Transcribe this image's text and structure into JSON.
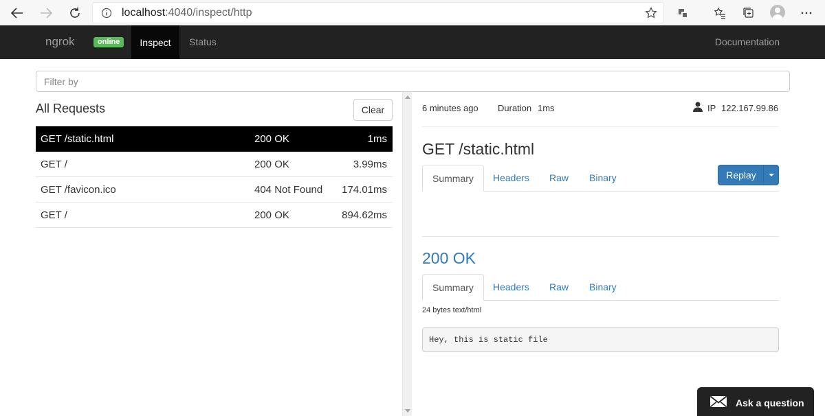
{
  "browser": {
    "url_host": "localhost",
    "url_rest": ":4040/inspect/http"
  },
  "navbar": {
    "brand": "ngrok",
    "badge": "online",
    "items": [
      {
        "label": "Inspect"
      },
      {
        "label": "Status"
      }
    ],
    "docs": "Documentation"
  },
  "filter": {
    "placeholder": "Filter by"
  },
  "requests": {
    "title": "All Requests",
    "clear_label": "Clear",
    "rows": [
      {
        "request": "GET /static.html",
        "status": "200 OK",
        "duration": "1ms"
      },
      {
        "request": "GET /",
        "status": "200 OK",
        "duration": "3.99ms"
      },
      {
        "request": "GET /favicon.ico",
        "status": "404 Not Found",
        "duration": "174.01ms"
      },
      {
        "request": "GET /",
        "status": "200 OK",
        "duration": "894.62ms"
      }
    ]
  },
  "detail": {
    "time_ago": "6 minutes ago",
    "duration_label": "Duration",
    "duration_value": "1ms",
    "ip_label": "IP",
    "ip_value": "122.167.99.86",
    "request_title": "GET /static.html",
    "tabs": [
      "Summary",
      "Headers",
      "Raw",
      "Binary"
    ],
    "replay_label": "Replay",
    "response_title": "200 OK",
    "response_meta": "24 bytes text/html",
    "response_body": "Hey, this is static file"
  },
  "ask": {
    "label": "Ask a question"
  },
  "colors": {
    "navbar": "#222222",
    "badge": "#5cb85c",
    "link": "#337ab7",
    "active_row": "#000000"
  }
}
